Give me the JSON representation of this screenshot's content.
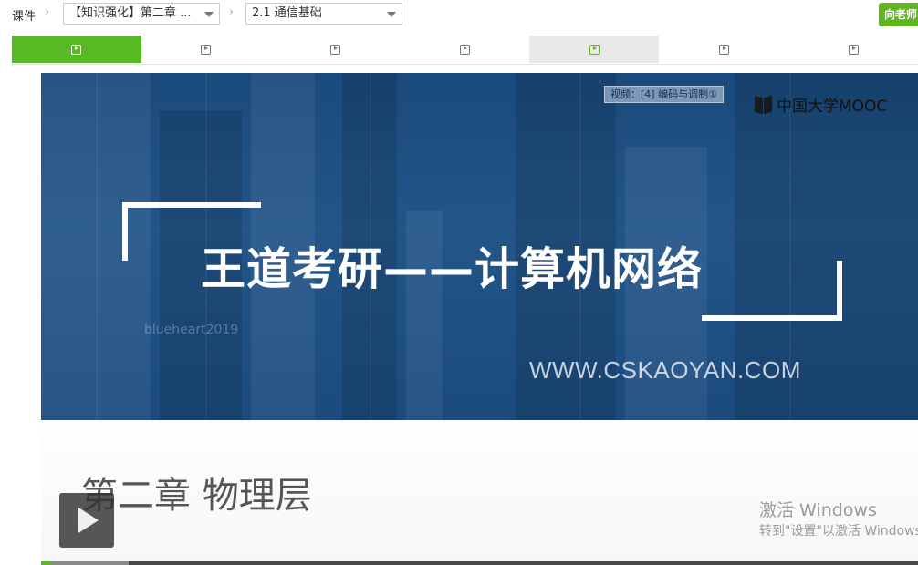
{
  "breadcrumb": {
    "root": "课件",
    "chapter_select": "【知识强化】第二章 ...",
    "lesson_select": "2.1 通信基础"
  },
  "ask_teacher_label": "向老师",
  "units": [
    {
      "icon": "video-icon",
      "state": "active"
    },
    {
      "icon": "video-icon",
      "state": "normal"
    },
    {
      "icon": "video-icon",
      "state": "normal"
    },
    {
      "icon": "video-icon",
      "state": "normal"
    },
    {
      "icon": "video-icon",
      "state": "hover"
    },
    {
      "icon": "video-icon",
      "state": "normal"
    },
    {
      "icon": "video-icon",
      "state": "normal"
    }
  ],
  "video": {
    "tag": "视频：[4] 编码与调制①",
    "logo_text": "中国大学MOOC",
    "title": "王道考研——计算机网络",
    "watermark": "blueheart2019",
    "website": "WWW.CSKAOYAN.COM",
    "chapter": "第二章 物理层",
    "progress_fraction": 0.01,
    "buffered_fraction": 0.1
  },
  "os_watermark": {
    "line1": "激活 Windows",
    "line2": "转到\"设置\"以激活 Windows。"
  },
  "colors": {
    "accent": "#57b923",
    "slide_blue": "#235589"
  }
}
